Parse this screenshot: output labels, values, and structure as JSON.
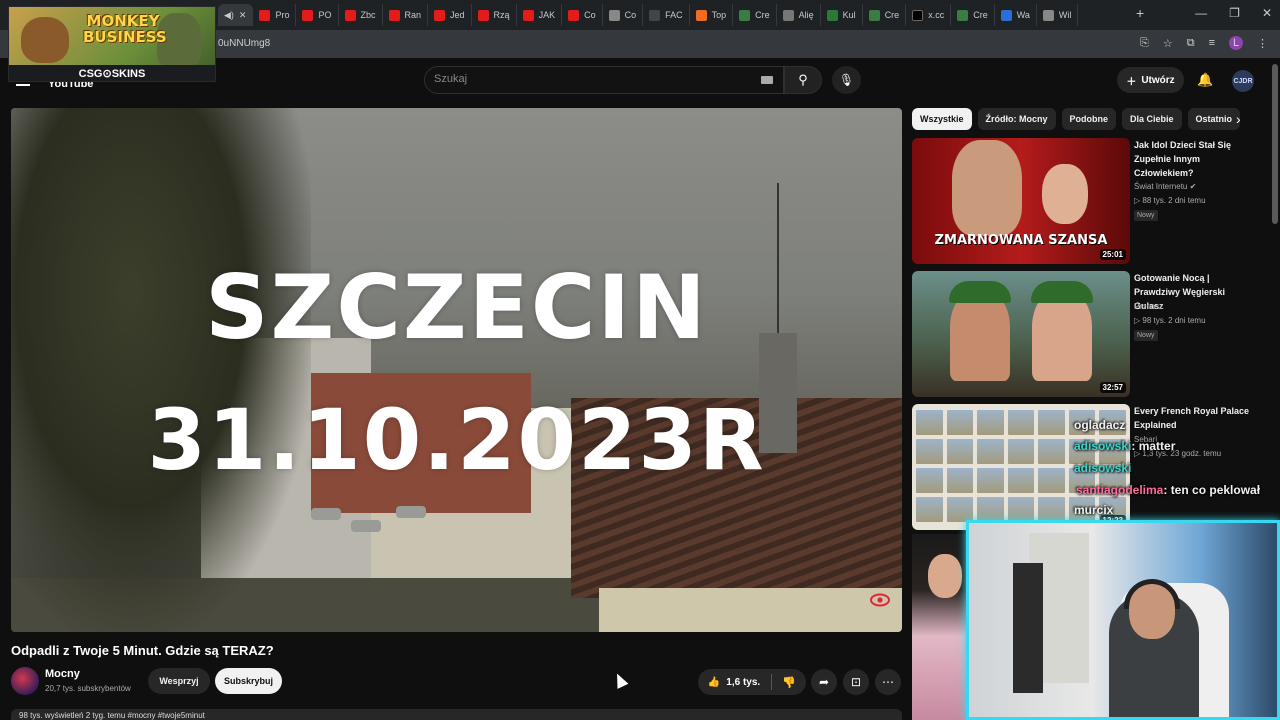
{
  "browser": {
    "tabs": [
      "Pro",
      "PO",
      "Zbc",
      "Ran",
      "Jed",
      "Rzą",
      "JAK",
      "Co",
      "Co",
      "FAC",
      "Top",
      "Cre",
      "Alię",
      "Kul",
      "Cre",
      "x.cc",
      "Cre",
      "Wa",
      "Wil"
    ],
    "url": "0uNNUmg8",
    "profile_letter": "L"
  },
  "banner": {
    "title": "MONKEY BUSINESS",
    "sponsor": "CSG⊙SKINS"
  },
  "youtube": {
    "logo": "YouTube",
    "search_placeholder": "Szukaj",
    "create_label": "Utwórz",
    "account_label": "CJDR"
  },
  "video": {
    "overlay_line1": "SZCZECIN",
    "overlay_line2": "31.10.2023R",
    "title": "Odpadli z Twoje 5 Minut. Gdzie są TERAZ?",
    "channel": "Mocny",
    "subscribers": "20,7 tys. subskrybentów",
    "support_label": "Wesprzyj",
    "subscribe_label": "Subskrybuj",
    "likes": "1,6 tys.",
    "description_preview": "98 tys. wyświetleń  2 tyg. temu  #mocny #twoje5minut"
  },
  "sidebar": {
    "chips": [
      "Wszystkie",
      "Źródło: Mocny",
      "Podobne",
      "Dla Ciebie",
      "Ostatnio"
    ],
    "recommendations": [
      {
        "title": "Jak Idol Dzieci Stał Się Zupełnie Innym Człowiekiem?",
        "channel": "Świat Internetu ✔",
        "meta": "▷ 88 tys.  2 dni temu",
        "badge": "Nowy",
        "duration": "25:01",
        "thumb_caption": "ZMARNOWANA SZANSA"
      },
      {
        "title": "Gotowanie Nocą | Prawdziwy Węgierski Gulasz",
        "channel": "Pronosz",
        "meta": "▷ 98 tys.  2 dni temu",
        "badge": "Nowy",
        "duration": "32:57"
      },
      {
        "title": "Every French Royal Palace Explained",
        "channel": "Sebari",
        "meta": "▷ 1,3 tys.  23 godz. temu",
        "duration": "12:23"
      }
    ]
  },
  "chat": [
    {
      "user": "ogladacz",
      "message": "",
      "color": "#ffffff"
    },
    {
      "user": "adisowski",
      "message": ": matter",
      "color": "#3cd4c8"
    },
    {
      "user": "adisowski",
      "message": "",
      "color": "#3cd4c8"
    },
    {
      "user": "santiagodelima",
      "message": ": ten co peklował",
      "color": "#ff6aa0"
    },
    {
      "user": "murcix",
      "message": "",
      "color": "#ffffff"
    }
  ]
}
